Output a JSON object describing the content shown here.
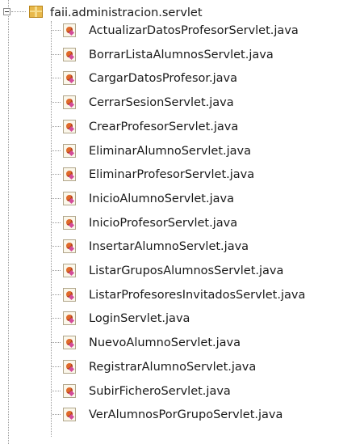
{
  "package": {
    "name": "faii.administracion.servlet",
    "icon": "package-icon",
    "expanded": true
  },
  "files": [
    {
      "name": "ActualizarDatosProfesorServlet.java"
    },
    {
      "name": "BorrarListaAlumnosServlet.java"
    },
    {
      "name": "CargarDatosProfesor.java"
    },
    {
      "name": "CerrarSesionServlet.java"
    },
    {
      "name": "CrearProfesorServlet.java"
    },
    {
      "name": "EliminarAlumnoServlet.java"
    },
    {
      "name": "EliminarProfesorServlet.java"
    },
    {
      "name": "InicioAlumnoServlet.java"
    },
    {
      "name": "InicioProfesorServlet.java"
    },
    {
      "name": "InsertarAlumnoServlet.java"
    },
    {
      "name": "ListarGruposAlumnosServlet.java"
    },
    {
      "name": "ListarProfesoresInvitadosServlet.java"
    },
    {
      "name": "LoginServlet.java"
    },
    {
      "name": "NuevoAlumnoServlet.java"
    },
    {
      "name": "RegistrarAlumnoServlet.java"
    },
    {
      "name": "SubirFicheroServlet.java"
    },
    {
      "name": "VerAlumnosPorGrupoServlet.java"
    }
  ],
  "colors": {
    "package_icon": "#e8b84a",
    "java_file_icon": "#e06a2b"
  }
}
